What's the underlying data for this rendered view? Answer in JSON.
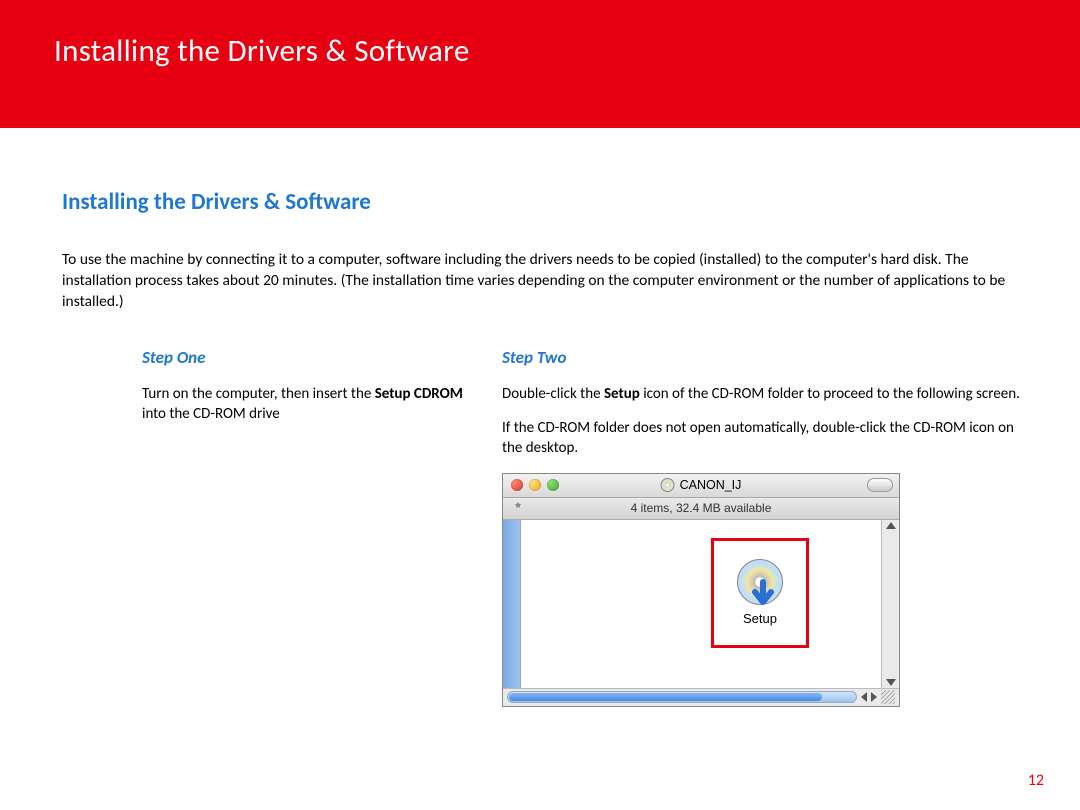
{
  "header": {
    "title": "Installing  the Drivers & Software"
  },
  "section": {
    "title": "Installing the Drivers & Software"
  },
  "intro": "To use the machine by connecting it to a computer, software including the drivers needs to be copied (installed) to the computer's hard disk. The installation process takes about 20 minutes. (The installation time varies depending on the computer environment or the number of applications to be installed.)",
  "steps": {
    "one": {
      "heading": "Step One",
      "text_a": "Turn on the computer, then insert the ",
      "bold_a": "Setup CDROM",
      "text_b": " into the CD-ROM drive"
    },
    "two": {
      "heading": "Step Two",
      "p1_a": "Double-click the ",
      "p1_bold": "Setup",
      "p1_b": " icon of the CD-ROM folder to proceed to the following screen.",
      "p2": "If the CD-ROM folder does not open automatically, double-click the CD-ROM icon on the desktop."
    }
  },
  "screenshot": {
    "window_title": "CANON_IJ",
    "status": "4 items, 32.4 MB available",
    "icon_label": "Setup"
  },
  "page_number": "12"
}
